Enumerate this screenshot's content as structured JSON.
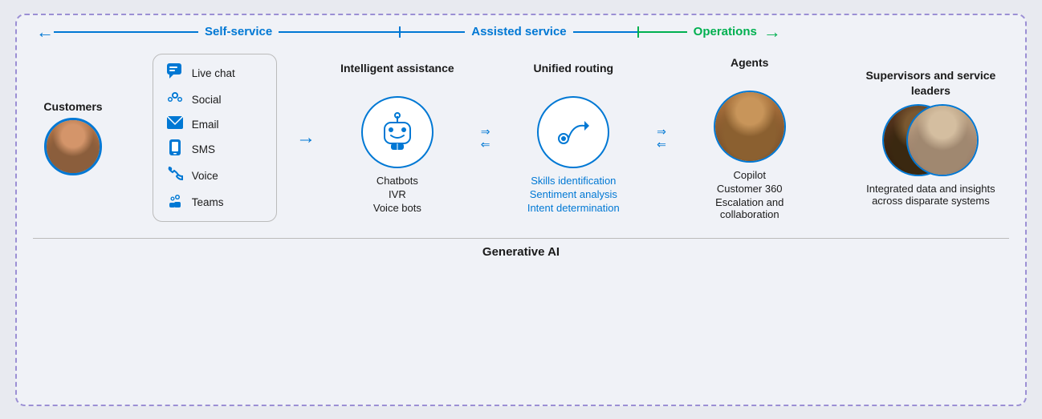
{
  "header": {
    "self_service_label": "Self-service",
    "assisted_service_label": "Assisted service",
    "operations_label": "Operations"
  },
  "customers": {
    "label": "Customers"
  },
  "channels": {
    "items": [
      {
        "icon": "chat-icon",
        "label": "Live chat"
      },
      {
        "icon": "social-icon",
        "label": "Social"
      },
      {
        "icon": "email-icon",
        "label": "Email"
      },
      {
        "icon": "sms-icon",
        "label": "SMS"
      },
      {
        "icon": "voice-icon",
        "label": "Voice"
      },
      {
        "icon": "teams-icon",
        "label": "Teams"
      }
    ]
  },
  "intelligent_assistance": {
    "title": "Intelligent assistance",
    "items": [
      "Chatbots",
      "IVR",
      "Voice bots"
    ]
  },
  "unified_routing": {
    "title": "Unified routing",
    "items_blue": [
      "Skills identification",
      "Sentiment analysis",
      "Intent determination"
    ]
  },
  "agents": {
    "title": "Agents",
    "items": [
      "Copilot",
      "Customer 360",
      "Escalation and collaboration"
    ]
  },
  "supervisors": {
    "title": "Supervisors and service leaders",
    "items": [
      "Integrated data and insights across disparate systems"
    ]
  },
  "footer": {
    "label": "Generative AI"
  }
}
